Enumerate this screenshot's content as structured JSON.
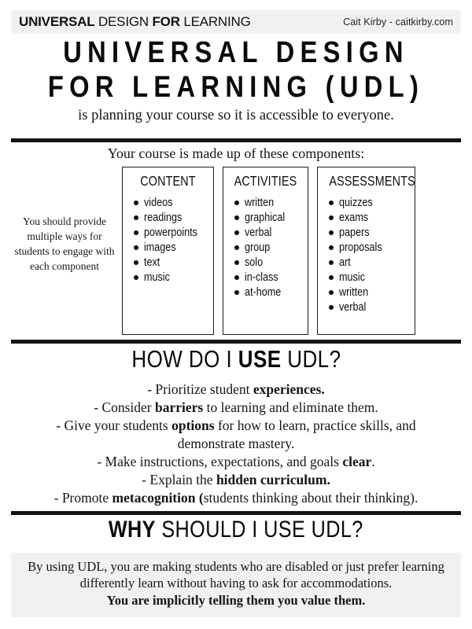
{
  "header": {
    "title_bold_1": "UNIVERSAL",
    "title_light_1": "DESIGN",
    "title_bold_2": "FOR",
    "title_light_2": "LEARNING",
    "credit": "Cait Kirby - caitkirby.com"
  },
  "title": {
    "line1": "UNIVERSAL DESIGN",
    "line2": "FOR LEARNING (UDL)",
    "subtitle": "is planning your course so it is accessible to everyone."
  },
  "components": {
    "caption": "Your course is made up of these components:",
    "side_note": "You should provide multiple ways for students to engage with each component",
    "boxes": [
      {
        "title": "CONTENT",
        "items": [
          "videos",
          "readings",
          "powerpoints",
          "images",
          "text",
          "music"
        ]
      },
      {
        "title": "ACTIVITIES",
        "items": [
          "written",
          "graphical",
          "verbal",
          "group",
          "solo",
          "in-class",
          "at-home"
        ]
      },
      {
        "title": "ASSESSMENTS",
        "items": [
          "quizzes",
          "exams",
          "papers",
          "proposals",
          "art",
          "music",
          "written",
          "verbal"
        ]
      }
    ]
  },
  "how": {
    "heading_pre": "HOW DO I ",
    "heading_emph": "USE",
    "heading_post": " UDL?",
    "lines": [
      {
        "pre": "- Prioritize student ",
        "bold": "experiences.",
        "post": ""
      },
      {
        "pre": "- Consider ",
        "bold": "barriers",
        "post": " to learning and eliminate them."
      },
      {
        "pre": "- Give your students ",
        "bold": "options",
        "post": " for how to learn, practice skills, and"
      },
      {
        "pre": "demonstrate mastery.",
        "bold": "",
        "post": ""
      },
      {
        "pre": "- Make instructions, expectations, and goals ",
        "bold": "clear",
        "post": "."
      },
      {
        "pre": "- Explain the ",
        "bold": "hidden curriculum.",
        "post": ""
      },
      {
        "pre": "- Promote ",
        "bold": "metacognition (",
        "post": "students thinking about their thinking)."
      }
    ]
  },
  "why": {
    "heading_emph": "WHY",
    "heading_post": " SHOULD I USE UDL?",
    "body": "By using UDL, you are making students who are disabled or just prefer learning differently learn without having to ask for accommodations.",
    "emphasis": "You are implicitly telling them you value them."
  },
  "colors": {
    "ink": "#111111",
    "panel_gray": "#f1f1f1",
    "rule": "#141414"
  }
}
